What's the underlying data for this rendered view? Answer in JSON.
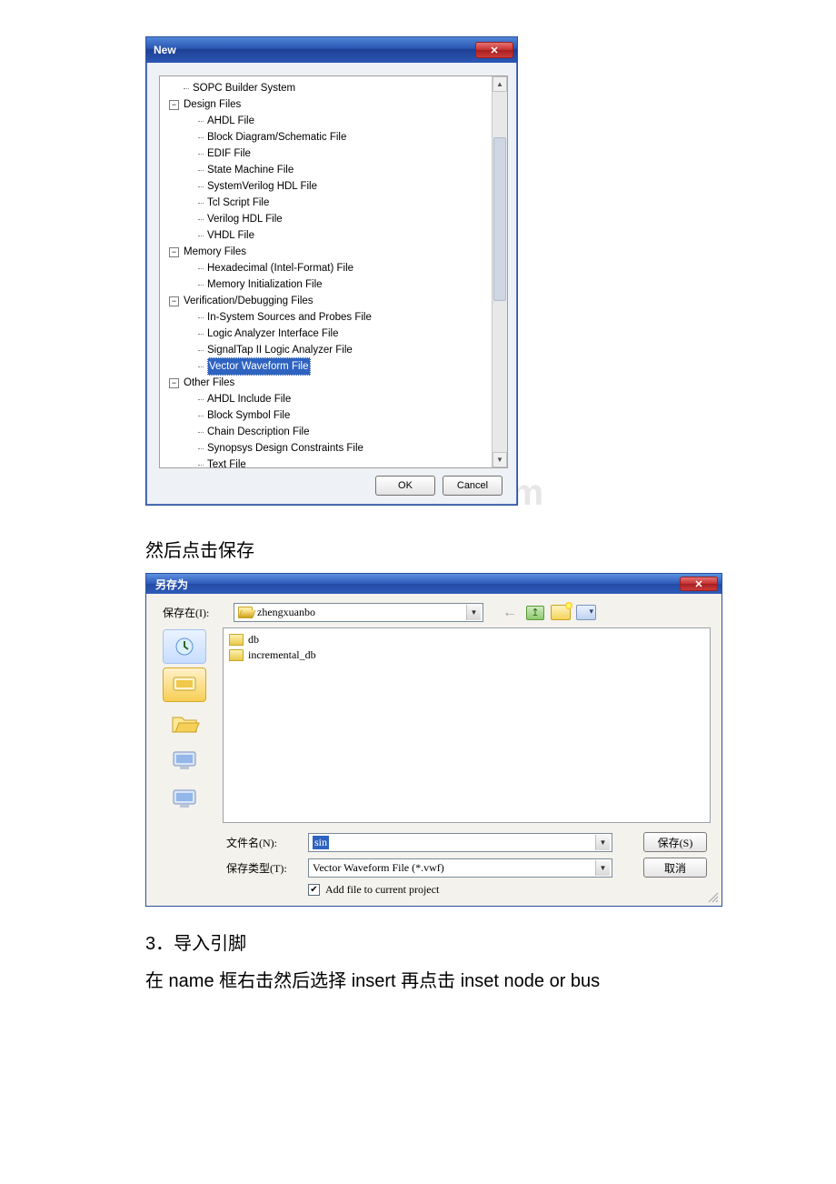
{
  "dialog_new": {
    "title": "New",
    "close_glyph": "✕",
    "tree": {
      "items": [
        {
          "level": "indent0",
          "expando": null,
          "label": "SOPC Builder System",
          "sel": false
        },
        {
          "level": "indent1",
          "expando": "−",
          "label": "Design Files",
          "sel": false
        },
        {
          "level": "indent2",
          "expando": null,
          "label": "AHDL File",
          "sel": false
        },
        {
          "level": "indent2",
          "expando": null,
          "label": "Block Diagram/Schematic File",
          "sel": false
        },
        {
          "level": "indent2",
          "expando": null,
          "label": "EDIF File",
          "sel": false
        },
        {
          "level": "indent2",
          "expando": null,
          "label": "State Machine File",
          "sel": false
        },
        {
          "level": "indent2",
          "expando": null,
          "label": "SystemVerilog HDL File",
          "sel": false
        },
        {
          "level": "indent2",
          "expando": null,
          "label": "Tcl Script File",
          "sel": false
        },
        {
          "level": "indent2",
          "expando": null,
          "label": "Verilog HDL File",
          "sel": false
        },
        {
          "level": "indent2",
          "expando": null,
          "label": "VHDL File",
          "sel": false
        },
        {
          "level": "indent1",
          "expando": "−",
          "label": "Memory Files",
          "sel": false
        },
        {
          "level": "indent2",
          "expando": null,
          "label": "Hexadecimal (Intel-Format) File",
          "sel": false
        },
        {
          "level": "indent2",
          "expando": null,
          "label": "Memory Initialization File",
          "sel": false
        },
        {
          "level": "indent1",
          "expando": "−",
          "label": "Verification/Debugging Files",
          "sel": false
        },
        {
          "level": "indent2",
          "expando": null,
          "label": "In-System Sources and Probes File",
          "sel": false
        },
        {
          "level": "indent2",
          "expando": null,
          "label": "Logic Analyzer Interface File",
          "sel": false
        },
        {
          "level": "indent2",
          "expando": null,
          "label": "SignalTap II Logic Analyzer File",
          "sel": false
        },
        {
          "level": "indent2",
          "expando": null,
          "label": "Vector Waveform File",
          "sel": true
        },
        {
          "level": "indent1",
          "expando": "−",
          "label": "Other Files",
          "sel": false
        },
        {
          "level": "indent2",
          "expando": null,
          "label": "AHDL Include File",
          "sel": false
        },
        {
          "level": "indent2",
          "expando": null,
          "label": "Block Symbol File",
          "sel": false
        },
        {
          "level": "indent2",
          "expando": null,
          "label": "Chain Description File",
          "sel": false
        },
        {
          "level": "indent2",
          "expando": null,
          "label": "Synopsys Design Constraints File",
          "sel": false
        },
        {
          "level": "indent2",
          "expando": null,
          "label": "Text File",
          "sel": false
        }
      ],
      "scroll_up": "▲",
      "scroll_down": "▼"
    },
    "ok": "OK",
    "cancel": "Cancel"
  },
  "watermark": "www.bdocx.com",
  "text_after_new": "然后点击保存",
  "dialog_save": {
    "title": "另存为",
    "close_glyph": "✕",
    "save_in_label": "保存在(I):",
    "save_in_value": "zhengxuanbo",
    "file_list": [
      {
        "icon": "folder",
        "name": "db"
      },
      {
        "icon": "folder",
        "name": "incremental_db"
      }
    ],
    "filename_label": "文件名(N):",
    "filename_value": "sin",
    "filetype_label": "保存类型(T):",
    "filetype_value": "Vector Waveform File (*.vwf)",
    "save_btn": "保存(S)",
    "cancel_btn": "取消",
    "add_to_project": "Add file to current project",
    "checked": "✔"
  },
  "section3_heading": "3．导入引脚",
  "section3_body": "在 name 框右击然后选择 insert 再点击 inset node or bus"
}
